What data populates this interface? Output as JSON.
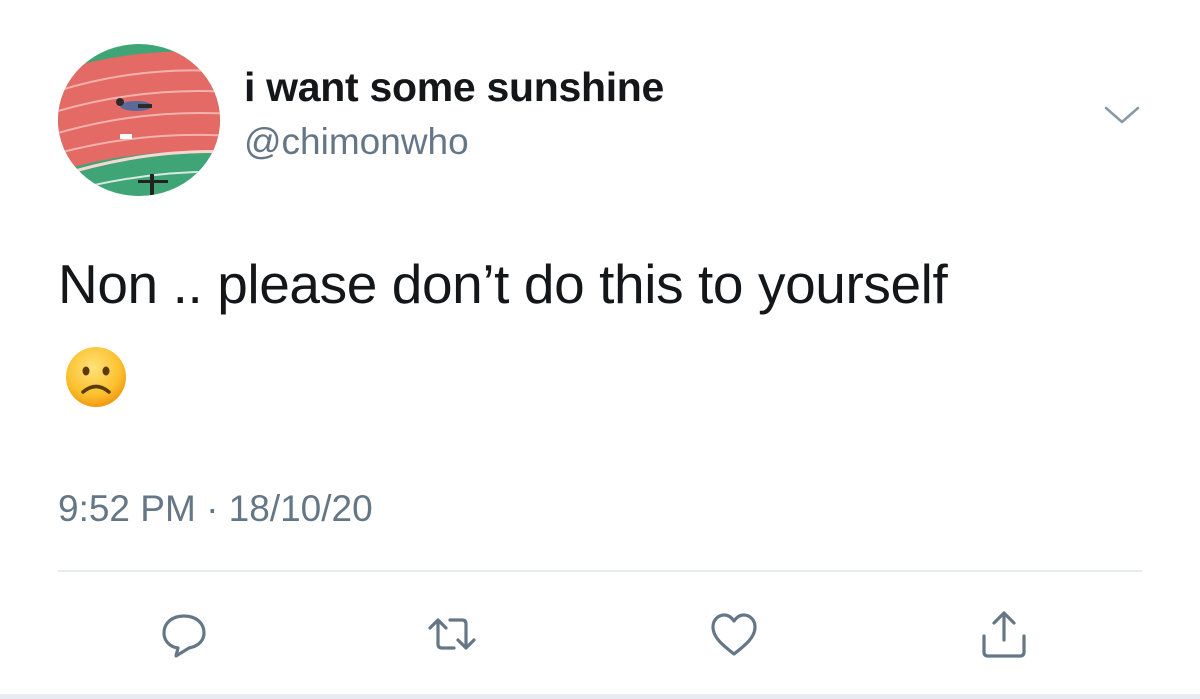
{
  "tweet": {
    "display_name": "i want some sunshine",
    "handle": "@chimonwho",
    "text": "Non .. please don’t do this to yourself",
    "emoji": "frowning-face",
    "timestamp": "9:52 PM · 18/10/20"
  },
  "icons": {
    "menu": "chevron-down-icon",
    "reply": "reply-icon",
    "retweet": "retweet-icon",
    "like": "heart-icon",
    "share": "share-icon"
  },
  "colors": {
    "text": "#14171a",
    "secondary": "#657786",
    "icon": "#657786",
    "divider": "#e6ecf0"
  }
}
